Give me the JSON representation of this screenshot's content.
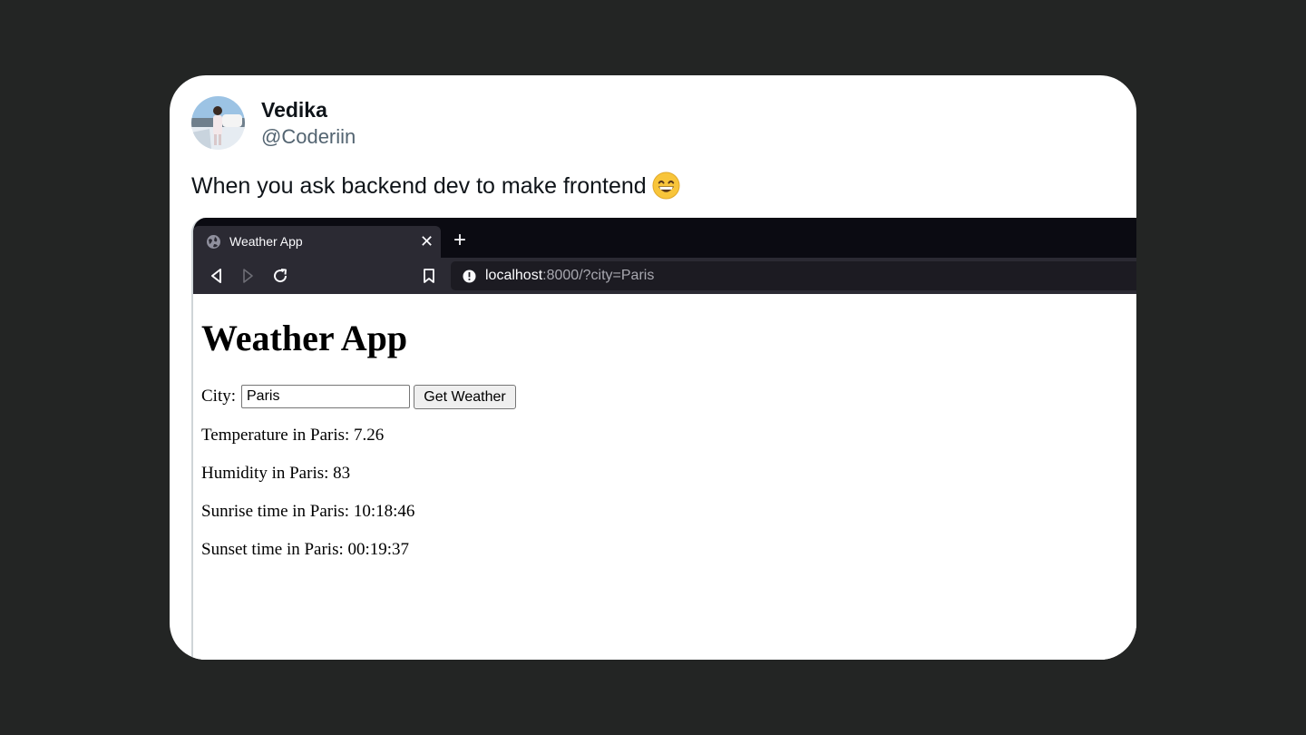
{
  "tweet": {
    "author_name": "Vedika",
    "author_handle": "@Coderiin",
    "text": "When you ask backend dev to make frontend",
    "emoji": "grinning-face-with-smiling-eyes"
  },
  "browser": {
    "tab_title": "Weather App",
    "tab_icon": "globe-icon",
    "url_host": "localhost",
    "url_rest": ":8000/?city=Paris"
  },
  "page": {
    "heading": "Weather App",
    "city_label": "City:",
    "city_value": "Paris",
    "button_label": "Get Weather",
    "results": [
      "Temperature in Paris: 7.26",
      "Humidity in Paris: 83",
      "Sunrise time in Paris: 10:18:46",
      "Sunset time in Paris: 00:19:37"
    ]
  },
  "colors": {
    "background": "#232524",
    "card": "#ffffff",
    "handle": "#536471",
    "browser_chrome": "#2b2a33",
    "tabstrip": "#0b0b12",
    "urlbar": "#1c1b22"
  }
}
